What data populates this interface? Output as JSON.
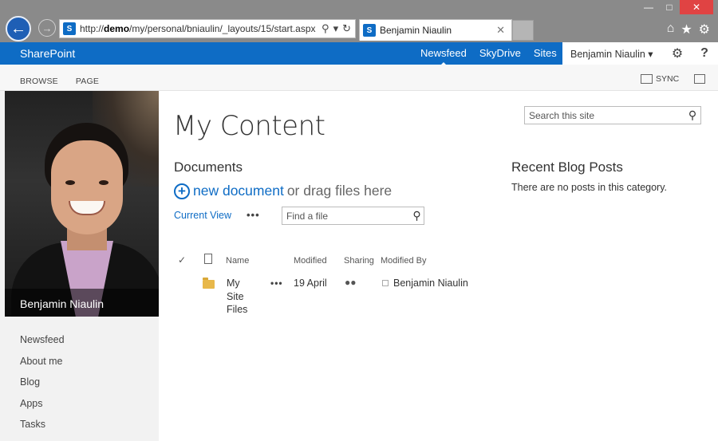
{
  "browser": {
    "url_prefix": "http://",
    "url_host": "demo",
    "url_path": "/my/personal/bniaulin/_layouts/15/start.aspx",
    "tab_title": "Benjamin Niaulin",
    "favicon": "S",
    "icons": [
      "back-arrow-icon",
      "forward-arrow-icon",
      "search-icon",
      "refresh-icon",
      "home-icon",
      "star-icon",
      "gear-icon"
    ]
  },
  "suite_bar": {
    "brand": "SharePoint",
    "nav": [
      "Newsfeed",
      "SkyDrive",
      "Sites"
    ],
    "active": "Newsfeed",
    "user": "Benjamin Niaulin ▾",
    "accent": "#0e6cc5"
  },
  "ribbon": {
    "tabs": [
      "BROWSE",
      "PAGE"
    ],
    "sync": "SYNC"
  },
  "profile": {
    "name": "Benjamin Niaulin"
  },
  "left_nav": [
    "Newsfeed",
    "About me",
    "Blog",
    "Apps",
    "Tasks"
  ],
  "page": {
    "title": "My Content",
    "search_placeholder": "Search this site"
  },
  "documents": {
    "heading": "Documents",
    "new_document": "new document",
    "drag_text": " or drag files here",
    "current_view": "Current View",
    "more": "•••",
    "find_placeholder": "Find a file",
    "columns": {
      "name": "Name",
      "modified": "Modified",
      "sharing": "Sharing",
      "modified_by": "Modified By"
    },
    "rows": [
      {
        "name_lines": [
          "My",
          "Site",
          "Files"
        ],
        "more": "•••",
        "modified": "19 April",
        "modified_by": "Benjamin Niaulin"
      }
    ]
  },
  "blog": {
    "heading": "Recent Blog Posts",
    "empty": "There are no posts in this category."
  }
}
